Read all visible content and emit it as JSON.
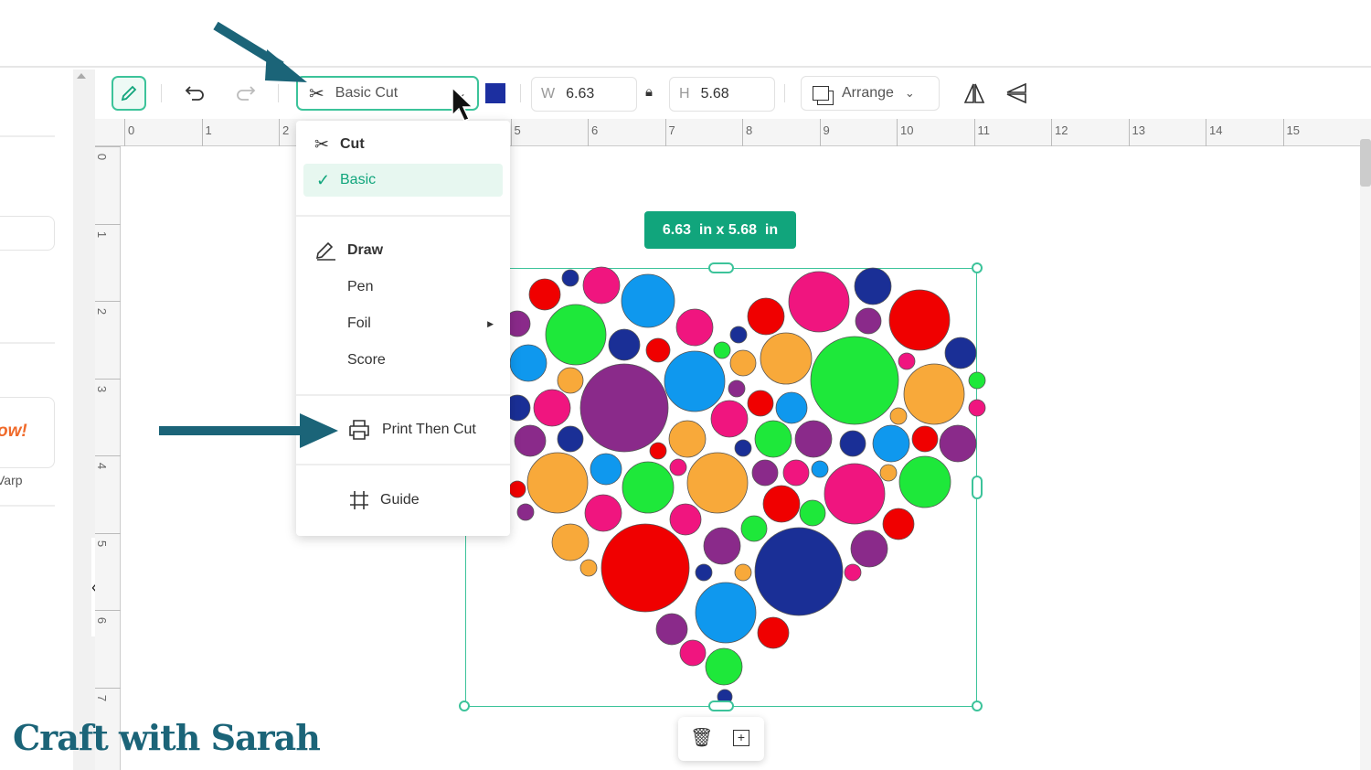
{
  "toolbar": {
    "operation_label": "Basic Cut",
    "color_swatch": "#1c2fa0",
    "width_label": "W",
    "width_value": "6.63",
    "height_label": "H",
    "height_value": "5.68",
    "arrange_label": "Arrange"
  },
  "ruler": {
    "h_ticks": [
      "0",
      "1",
      "2",
      "5",
      "6",
      "7",
      "8",
      "9",
      "10",
      "11",
      "12",
      "13",
      "14",
      "15"
    ],
    "v_ticks": [
      "0",
      "1",
      "2",
      "3",
      "4",
      "5",
      "6",
      "7"
    ]
  },
  "operation_menu": {
    "cut_header": "Cut",
    "cut_items": [
      {
        "label": "Basic",
        "selected": true
      }
    ],
    "draw_header": "Draw",
    "draw_items": [
      {
        "label": "Pen"
      },
      {
        "label": "Foil",
        "has_submenu": true
      },
      {
        "label": "Score"
      }
    ],
    "print_then_cut": "Print Then Cut",
    "guide": "Guide"
  },
  "left_panel": {
    "banner_text": "ow!",
    "caption": "Varp"
  },
  "canvas": {
    "size_tag": "6.63  in x 5.68  in",
    "palette": {
      "red": "#f00000",
      "pink": "#f0157f",
      "purple": "#8a2a8a",
      "blue": "#0f98ee",
      "navy": "#1a2f96",
      "green": "#1ee83a",
      "orange": "#f8a93a"
    },
    "accent": "#3cc39a"
  },
  "watermark": "Craft with Sarah"
}
